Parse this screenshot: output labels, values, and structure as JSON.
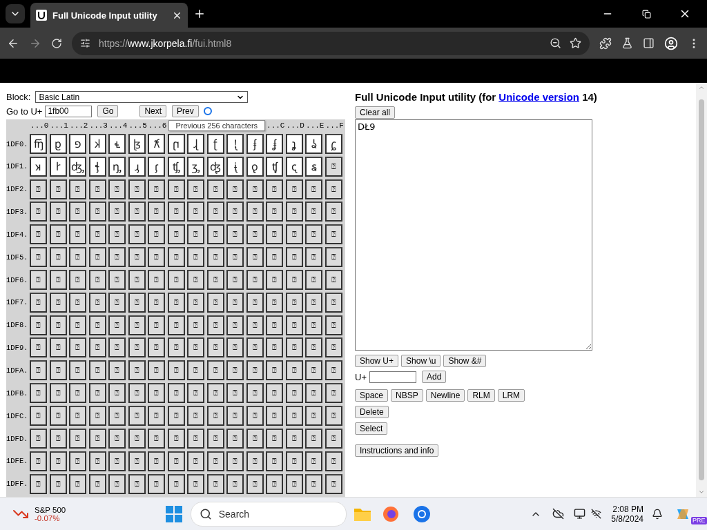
{
  "browser": {
    "tab_title": "Full Unicode Input utility",
    "url_scheme": "https://",
    "url_host": "www.jkorpela.fi",
    "url_path": "/fui.html8"
  },
  "controls": {
    "block_label": "Block:",
    "block_value": "Basic Latin",
    "goto_label": "Go to U+",
    "goto_value": "1fb00",
    "go_button": "Go",
    "next_button": "Next",
    "prev_button": "Prev"
  },
  "tooltip": "Previous 256 characters",
  "grid": {
    "columns_left": [
      "...0",
      "...1",
      "...2",
      "...3",
      "...4",
      "...5",
      "...6"
    ],
    "columns_right": [
      "...C",
      "...D",
      "...E",
      "...F"
    ],
    "rows": [
      {
        "label": "1DF0.",
        "cells": [
          {
            "char": "𝼀",
            "assigned": true
          },
          {
            "char": "𝼁",
            "assigned": true
          },
          {
            "char": "𝼂",
            "assigned": true
          },
          {
            "char": "𝼃",
            "assigned": true
          },
          {
            "char": "𝼄",
            "assigned": true
          },
          {
            "char": "𝼅",
            "assigned": true
          },
          {
            "char": "𝼆",
            "assigned": true
          },
          {
            "char": "𝼇",
            "assigned": true
          },
          {
            "char": "𝼈",
            "assigned": true
          },
          {
            "char": "𝼉",
            "assigned": true
          },
          {
            "char": "𝼊",
            "assigned": true
          },
          {
            "char": "𝼋",
            "assigned": true
          },
          {
            "char": "𝼌",
            "assigned": true
          },
          {
            "char": "𝼍",
            "assigned": true
          },
          {
            "char": "𝼎",
            "assigned": true
          },
          {
            "char": "𝼏",
            "assigned": true
          }
        ]
      },
      {
        "label": "1DF1.",
        "cells": [
          {
            "char": "𝼐",
            "assigned": true
          },
          {
            "char": "𝼑",
            "assigned": true
          },
          {
            "char": "𝼒",
            "assigned": true
          },
          {
            "char": "𝼓",
            "assigned": true
          },
          {
            "char": "𝼔",
            "assigned": true
          },
          {
            "char": "𝼕",
            "assigned": true
          },
          {
            "char": "𝼖",
            "assigned": true
          },
          {
            "char": "𝼗",
            "assigned": true
          },
          {
            "char": "𝼘",
            "assigned": true
          },
          {
            "char": "𝼙",
            "assigned": true
          },
          {
            "char": "𝼚",
            "assigned": true
          },
          {
            "char": "𝼛",
            "assigned": true
          },
          {
            "char": "𝼜",
            "assigned": true
          },
          {
            "char": "𝼝",
            "assigned": true
          },
          {
            "char": "𝼞",
            "assigned": true
          },
          {
            "char": "⍰",
            "assigned": false
          }
        ]
      },
      {
        "label": "1DF2.",
        "cells": [
          {
            "char": "⍰",
            "assigned": false
          },
          {
            "char": "⍰",
            "assigned": false
          },
          {
            "char": "⍰",
            "assigned": false
          },
          {
            "char": "⍰",
            "assigned": false
          },
          {
            "char": "⍰",
            "assigned": false
          },
          {
            "char": "⍰",
            "assigned": false
          },
          {
            "char": "⍰",
            "assigned": false
          },
          {
            "char": "⍰",
            "assigned": false
          },
          {
            "char": "⍰",
            "assigned": false
          },
          {
            "char": "⍰",
            "assigned": false
          },
          {
            "char": "⍰",
            "assigned": false
          },
          {
            "char": "⍰",
            "assigned": false
          },
          {
            "char": "⍰",
            "assigned": false
          },
          {
            "char": "⍰",
            "assigned": false
          },
          {
            "char": "⍰",
            "assigned": false
          },
          {
            "char": "⍰",
            "assigned": false
          }
        ]
      },
      {
        "label": "1DF3.",
        "cells": [
          {
            "char": "⍰",
            "assigned": false
          },
          {
            "char": "⍰",
            "assigned": false
          },
          {
            "char": "⍰",
            "assigned": false
          },
          {
            "char": "⍰",
            "assigned": false
          },
          {
            "char": "⍰",
            "assigned": false
          },
          {
            "char": "⍰",
            "assigned": false
          },
          {
            "char": "⍰",
            "assigned": false
          },
          {
            "char": "⍰",
            "assigned": false
          },
          {
            "char": "⍰",
            "assigned": false
          },
          {
            "char": "⍰",
            "assigned": false
          },
          {
            "char": "⍰",
            "assigned": false
          },
          {
            "char": "⍰",
            "assigned": false
          },
          {
            "char": "⍰",
            "assigned": false
          },
          {
            "char": "⍰",
            "assigned": false
          },
          {
            "char": "⍰",
            "assigned": false
          },
          {
            "char": "⍰",
            "assigned": false
          }
        ]
      },
      {
        "label": "1DF4.",
        "cells": [
          {
            "char": "⍰",
            "assigned": false
          },
          {
            "char": "⍰",
            "assigned": false
          },
          {
            "char": "⍰",
            "assigned": false
          },
          {
            "char": "⍰",
            "assigned": false
          },
          {
            "char": "⍰",
            "assigned": false
          },
          {
            "char": "⍰",
            "assigned": false
          },
          {
            "char": "⍰",
            "assigned": false
          },
          {
            "char": "⍰",
            "assigned": false
          },
          {
            "char": "⍰",
            "assigned": false
          },
          {
            "char": "⍰",
            "assigned": false
          },
          {
            "char": "⍰",
            "assigned": false
          },
          {
            "char": "⍰",
            "assigned": false
          },
          {
            "char": "⍰",
            "assigned": false
          },
          {
            "char": "⍰",
            "assigned": false
          },
          {
            "char": "⍰",
            "assigned": false
          },
          {
            "char": "⍰",
            "assigned": false
          }
        ]
      },
      {
        "label": "1DF5.",
        "cells": [
          {
            "char": "⍰",
            "assigned": false
          },
          {
            "char": "⍰",
            "assigned": false
          },
          {
            "char": "⍰",
            "assigned": false
          },
          {
            "char": "⍰",
            "assigned": false
          },
          {
            "char": "⍰",
            "assigned": false
          },
          {
            "char": "⍰",
            "assigned": false
          },
          {
            "char": "⍰",
            "assigned": false
          },
          {
            "char": "⍰",
            "assigned": false
          },
          {
            "char": "⍰",
            "assigned": false
          },
          {
            "char": "⍰",
            "assigned": false
          },
          {
            "char": "⍰",
            "assigned": false
          },
          {
            "char": "⍰",
            "assigned": false
          },
          {
            "char": "⍰",
            "assigned": false
          },
          {
            "char": "⍰",
            "assigned": false
          },
          {
            "char": "⍰",
            "assigned": false
          },
          {
            "char": "⍰",
            "assigned": false
          }
        ]
      },
      {
        "label": "1DF6.",
        "cells": [
          {
            "char": "⍰",
            "assigned": false
          },
          {
            "char": "⍰",
            "assigned": false
          },
          {
            "char": "⍰",
            "assigned": false
          },
          {
            "char": "⍰",
            "assigned": false
          },
          {
            "char": "⍰",
            "assigned": false
          },
          {
            "char": "⍰",
            "assigned": false
          },
          {
            "char": "⍰",
            "assigned": false
          },
          {
            "char": "⍰",
            "assigned": false
          },
          {
            "char": "⍰",
            "assigned": false
          },
          {
            "char": "⍰",
            "assigned": false
          },
          {
            "char": "⍰",
            "assigned": false
          },
          {
            "char": "⍰",
            "assigned": false
          },
          {
            "char": "⍰",
            "assigned": false
          },
          {
            "char": "⍰",
            "assigned": false
          },
          {
            "char": "⍰",
            "assigned": false
          },
          {
            "char": "⍰",
            "assigned": false
          }
        ]
      },
      {
        "label": "1DF7.",
        "cells": [
          {
            "char": "⍰",
            "assigned": false
          },
          {
            "char": "⍰",
            "assigned": false
          },
          {
            "char": "⍰",
            "assigned": false
          },
          {
            "char": "⍰",
            "assigned": false
          },
          {
            "char": "⍰",
            "assigned": false
          },
          {
            "char": "⍰",
            "assigned": false
          },
          {
            "char": "⍰",
            "assigned": false
          },
          {
            "char": "⍰",
            "assigned": false
          },
          {
            "char": "⍰",
            "assigned": false
          },
          {
            "char": "⍰",
            "assigned": false
          },
          {
            "char": "⍰",
            "assigned": false
          },
          {
            "char": "⍰",
            "assigned": false
          },
          {
            "char": "⍰",
            "assigned": false
          },
          {
            "char": "⍰",
            "assigned": false
          },
          {
            "char": "⍰",
            "assigned": false
          },
          {
            "char": "⍰",
            "assigned": false
          }
        ]
      },
      {
        "label": "1DF8.",
        "cells": [
          {
            "char": "⍰",
            "assigned": false
          },
          {
            "char": "⍰",
            "assigned": false
          },
          {
            "char": "⍰",
            "assigned": false
          },
          {
            "char": "⍰",
            "assigned": false
          },
          {
            "char": "⍰",
            "assigned": false
          },
          {
            "char": "⍰",
            "assigned": false
          },
          {
            "char": "⍰",
            "assigned": false
          },
          {
            "char": "⍰",
            "assigned": false
          },
          {
            "char": "⍰",
            "assigned": false
          },
          {
            "char": "⍰",
            "assigned": false
          },
          {
            "char": "⍰",
            "assigned": false
          },
          {
            "char": "⍰",
            "assigned": false
          },
          {
            "char": "⍰",
            "assigned": false
          },
          {
            "char": "⍰",
            "assigned": false
          },
          {
            "char": "⍰",
            "assigned": false
          },
          {
            "char": "⍰",
            "assigned": false
          }
        ]
      },
      {
        "label": "1DF9.",
        "cells": [
          {
            "char": "⍰",
            "assigned": false
          },
          {
            "char": "⍰",
            "assigned": false
          },
          {
            "char": "⍰",
            "assigned": false
          },
          {
            "char": "⍰",
            "assigned": false
          },
          {
            "char": "⍰",
            "assigned": false
          },
          {
            "char": "⍰",
            "assigned": false
          },
          {
            "char": "⍰",
            "assigned": false
          },
          {
            "char": "⍰",
            "assigned": false
          },
          {
            "char": "⍰",
            "assigned": false
          },
          {
            "char": "⍰",
            "assigned": false
          },
          {
            "char": "⍰",
            "assigned": false
          },
          {
            "char": "⍰",
            "assigned": false
          },
          {
            "char": "⍰",
            "assigned": false
          },
          {
            "char": "⍰",
            "assigned": false
          },
          {
            "char": "⍰",
            "assigned": false
          },
          {
            "char": "⍰",
            "assigned": false
          }
        ]
      },
      {
        "label": "1DFA.",
        "cells": [
          {
            "char": "⍰",
            "assigned": false
          },
          {
            "char": "⍰",
            "assigned": false
          },
          {
            "char": "⍰",
            "assigned": false
          },
          {
            "char": "⍰",
            "assigned": false
          },
          {
            "char": "⍰",
            "assigned": false
          },
          {
            "char": "⍰",
            "assigned": false
          },
          {
            "char": "⍰",
            "assigned": false
          },
          {
            "char": "⍰",
            "assigned": false
          },
          {
            "char": "⍰",
            "assigned": false
          },
          {
            "char": "⍰",
            "assigned": false
          },
          {
            "char": "⍰",
            "assigned": false
          },
          {
            "char": "⍰",
            "assigned": false
          },
          {
            "char": "⍰",
            "assigned": false
          },
          {
            "char": "⍰",
            "assigned": false
          },
          {
            "char": "⍰",
            "assigned": false
          },
          {
            "char": "⍰",
            "assigned": false
          }
        ]
      },
      {
        "label": "1DFB.",
        "cells": [
          {
            "char": "⍰",
            "assigned": false
          },
          {
            "char": "⍰",
            "assigned": false
          },
          {
            "char": "⍰",
            "assigned": false
          },
          {
            "char": "⍰",
            "assigned": false
          },
          {
            "char": "⍰",
            "assigned": false
          },
          {
            "char": "⍰",
            "assigned": false
          },
          {
            "char": "⍰",
            "assigned": false
          },
          {
            "char": "⍰",
            "assigned": false
          },
          {
            "char": "⍰",
            "assigned": false
          },
          {
            "char": "⍰",
            "assigned": false
          },
          {
            "char": "⍰",
            "assigned": false
          },
          {
            "char": "⍰",
            "assigned": false
          },
          {
            "char": "⍰",
            "assigned": false
          },
          {
            "char": "⍰",
            "assigned": false
          },
          {
            "char": "⍰",
            "assigned": false
          },
          {
            "char": "⍰",
            "assigned": false
          }
        ]
      },
      {
        "label": "1DFC.",
        "cells": [
          {
            "char": "⍰",
            "assigned": false
          },
          {
            "char": "⍰",
            "assigned": false
          },
          {
            "char": "⍰",
            "assigned": false
          },
          {
            "char": "⍰",
            "assigned": false
          },
          {
            "char": "⍰",
            "assigned": false
          },
          {
            "char": "⍰",
            "assigned": false
          },
          {
            "char": "⍰",
            "assigned": false
          },
          {
            "char": "⍰",
            "assigned": false
          },
          {
            "char": "⍰",
            "assigned": false
          },
          {
            "char": "⍰",
            "assigned": false
          },
          {
            "char": "⍰",
            "assigned": false
          },
          {
            "char": "⍰",
            "assigned": false
          },
          {
            "char": "⍰",
            "assigned": false
          },
          {
            "char": "⍰",
            "assigned": false
          },
          {
            "char": "⍰",
            "assigned": false
          },
          {
            "char": "⍰",
            "assigned": false
          }
        ]
      },
      {
        "label": "1DFD.",
        "cells": [
          {
            "char": "⍰",
            "assigned": false
          },
          {
            "char": "⍰",
            "assigned": false
          },
          {
            "char": "⍰",
            "assigned": false
          },
          {
            "char": "⍰",
            "assigned": false
          },
          {
            "char": "⍰",
            "assigned": false
          },
          {
            "char": "⍰",
            "assigned": false
          },
          {
            "char": "⍰",
            "assigned": false
          },
          {
            "char": "⍰",
            "assigned": false
          },
          {
            "char": "⍰",
            "assigned": false
          },
          {
            "char": "⍰",
            "assigned": false
          },
          {
            "char": "⍰",
            "assigned": false
          },
          {
            "char": "⍰",
            "assigned": false
          },
          {
            "char": "⍰",
            "assigned": false
          },
          {
            "char": "⍰",
            "assigned": false
          },
          {
            "char": "⍰",
            "assigned": false
          },
          {
            "char": "⍰",
            "assigned": false
          }
        ]
      },
      {
        "label": "1DFE.",
        "cells": [
          {
            "char": "⍰",
            "assigned": false
          },
          {
            "char": "⍰",
            "assigned": false
          },
          {
            "char": "⍰",
            "assigned": false
          },
          {
            "char": "⍰",
            "assigned": false
          },
          {
            "char": "⍰",
            "assigned": false
          },
          {
            "char": "⍰",
            "assigned": false
          },
          {
            "char": "⍰",
            "assigned": false
          },
          {
            "char": "⍰",
            "assigned": false
          },
          {
            "char": "⍰",
            "assigned": false
          },
          {
            "char": "⍰",
            "assigned": false
          },
          {
            "char": "⍰",
            "assigned": false
          },
          {
            "char": "⍰",
            "assigned": false
          },
          {
            "char": "⍰",
            "assigned": false
          },
          {
            "char": "⍰",
            "assigned": false
          },
          {
            "char": "⍰",
            "assigned": false
          },
          {
            "char": "⍰",
            "assigned": false
          }
        ]
      },
      {
        "label": "1DFF.",
        "cells": [
          {
            "char": "⍰",
            "assigned": false
          },
          {
            "char": "⍰",
            "assigned": false
          },
          {
            "char": "⍰",
            "assigned": false
          },
          {
            "char": "⍰",
            "assigned": false
          },
          {
            "char": "⍰",
            "assigned": false
          },
          {
            "char": "⍰",
            "assigned": false
          },
          {
            "char": "⍰",
            "assigned": false
          },
          {
            "char": "⍰",
            "assigned": false
          },
          {
            "char": "⍰",
            "assigned": false
          },
          {
            "char": "⍰",
            "assigned": false
          },
          {
            "char": "⍰",
            "assigned": false
          },
          {
            "char": "⍰",
            "assigned": false
          },
          {
            "char": "⍰",
            "assigned": false
          },
          {
            "char": "⍰",
            "assigned": false
          },
          {
            "char": "⍰",
            "assigned": false
          },
          {
            "char": "⍰",
            "assigned": false
          }
        ]
      }
    ]
  },
  "panel": {
    "title": "Full Unicode Input utility (for ",
    "title_link": "Unicode version",
    "title_end": " 14)",
    "clear_button": "Clear all",
    "text_value": "DŁ9",
    "show_buttons": [
      "Show U+",
      "Show \\u",
      "Show &#"
    ],
    "add_label": "U+",
    "add_button": "Add",
    "insert_buttons": [
      "Space",
      "NBSP",
      "Newline",
      "RLM",
      "LRM"
    ],
    "delete_button": "Delete",
    "select_button": "Select",
    "info_button": "Instructions and info"
  },
  "taskbar": {
    "stock_name": "S&P 500",
    "stock_change": "-0.07%",
    "search_placeholder": "Search",
    "time": "2:08 PM",
    "date": "5/8/2024",
    "copilot_badge": "PRE"
  }
}
